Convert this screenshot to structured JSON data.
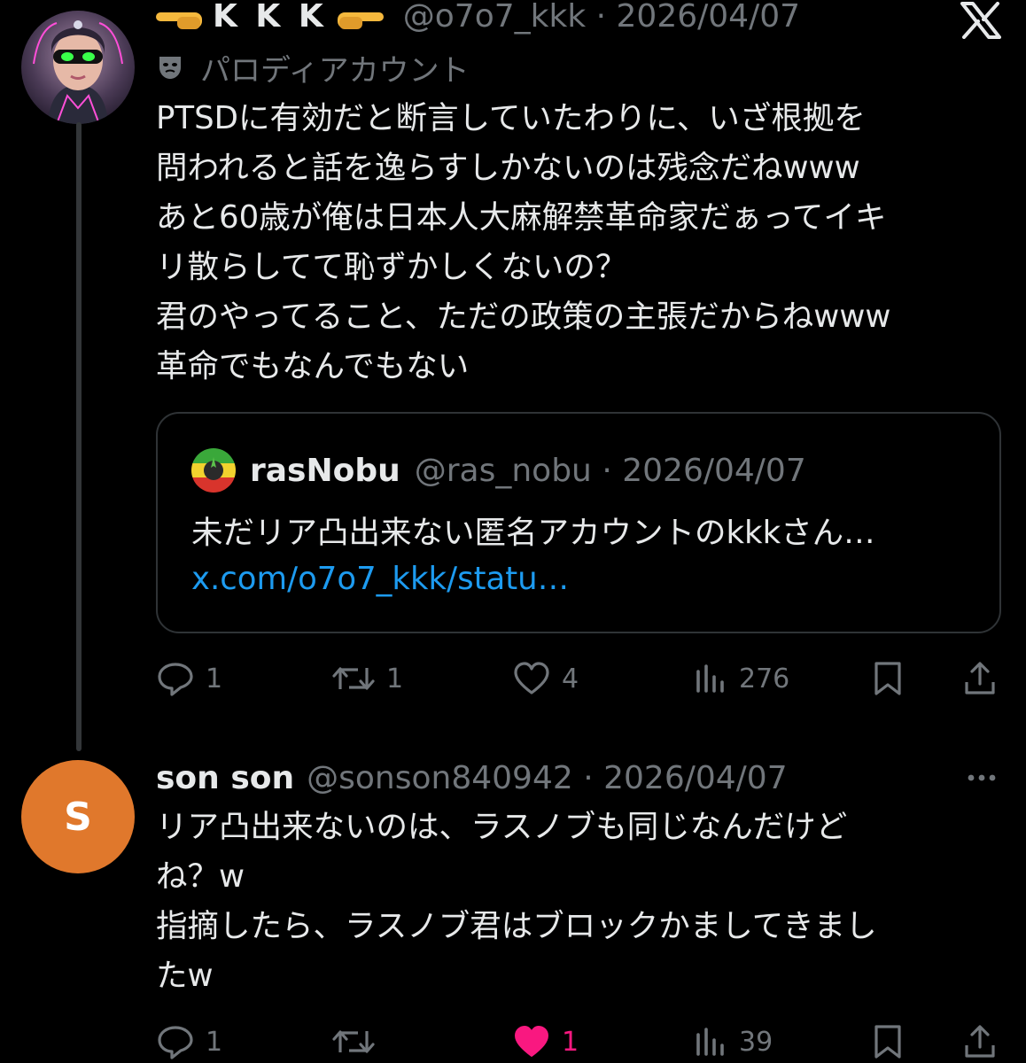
{
  "main_tweet": {
    "display_name": "K K K",
    "handle": "@o7o7_kkk",
    "date": "2026/04/07",
    "separator": "·",
    "parody_label": "パロディアカウント",
    "text": "PTSDに有効だと断言していたわりに、いざ根拠を\n問われると話を逸らすしかないのは残念だねwww\nあと60歳が俺は日本人大麻解禁革命家だぁってイキ\nリ散らしてて恥ずかしくないの？\n君のやってること、ただの政策の主張だからねwww\n革命でもなんでもない",
    "quote": {
      "name": "rasNobu",
      "handle": "@ras_nobu",
      "date": "2026/04/07",
      "text": "未だリア凸出来ない匿名アカウントのkkkさん…",
      "link": "x.com/o7o7_kkk/statu…"
    },
    "stats": {
      "replies": "1",
      "reposts": "1",
      "likes": "4",
      "views": "276"
    },
    "icons": [
      "x-logo",
      "theater-mask-icon",
      "reply-icon",
      "repost-icon",
      "like-icon",
      "views-icon",
      "bookmark-icon",
      "share-icon"
    ]
  },
  "reply_tweet": {
    "avatar_letter": "S",
    "display_name": "son son",
    "handle": "@sonson840942",
    "date": "2026/04/07",
    "separator": "·",
    "text": "リア凸出来ないのは、ラスノブも同じなんだけど\nね？w\n指摘したら、ラスノブ君はブロックかましてきまし\nたw",
    "stats": {
      "replies": "1",
      "likes": "1",
      "views": "39"
    },
    "liked": true
  },
  "colors": {
    "background": "#000000",
    "text": "#e7e9ea",
    "secondary": "#71767b",
    "link": "#1d9bf0",
    "like": "#f91880",
    "border": "#2f3336",
    "reply_avatar": "#e0782c"
  }
}
